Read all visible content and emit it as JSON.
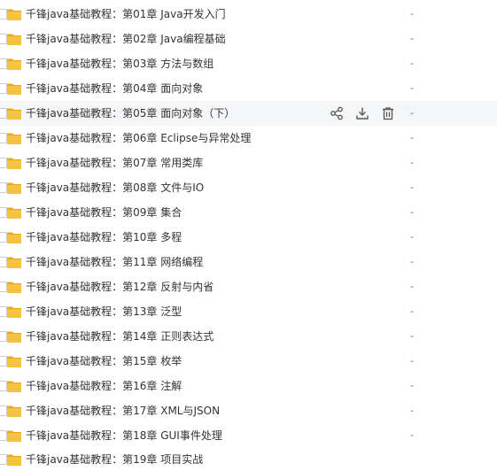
{
  "files": [
    {
      "name": "千锋java基础教程：第01章 Java开发入门",
      "size": "-"
    },
    {
      "name": "千锋java基础教程：第02章 Java编程基础",
      "size": "-"
    },
    {
      "name": "千锋java基础教程：第03章 方法与数组",
      "size": "-"
    },
    {
      "name": "千锋java基础教程：第04章 面向对象",
      "size": "-"
    },
    {
      "name": "千锋java基础教程：第05章 面向对象（下）",
      "size": "-"
    },
    {
      "name": "千锋java基础教程：第06章 Eclipse与异常处理",
      "size": "-"
    },
    {
      "name": "千锋java基础教程：第07章 常用类库",
      "size": "-"
    },
    {
      "name": "千锋java基础教程：第08章 文件与IO",
      "size": "-"
    },
    {
      "name": "千锋java基础教程：第09章 集合",
      "size": "-"
    },
    {
      "name": "千锋java基础教程：第10章 多程",
      "size": "-"
    },
    {
      "name": "千锋java基础教程：第11章 网络编程",
      "size": "-"
    },
    {
      "name": "千锋java基础教程：第12章 反射与内省",
      "size": "-"
    },
    {
      "name": "千锋java基础教程：第13章 泛型",
      "size": "-"
    },
    {
      "name": "千锋java基础教程：第14章 正则表达式",
      "size": "-"
    },
    {
      "name": "千锋java基础教程：第15章 枚举",
      "size": "-"
    },
    {
      "name": "千锋java基础教程：第16章 注解",
      "size": "-"
    },
    {
      "name": "千锋java基础教程：第17章 XML与JSON",
      "size": "-"
    },
    {
      "name": "千锋java基础教程：第18章 GUI事件处理",
      "size": "-"
    },
    {
      "name": "千锋java基础教程：第19章 项目实战",
      "size": "-"
    }
  ],
  "hovered_row": 4,
  "row_actions": [
    "share-icon",
    "download-icon",
    "delete-icon"
  ],
  "colors": {
    "folder": "#f5c342",
    "folder_tab": "#e8aa1c",
    "hover": "#f5f6f8",
    "icon": "#555555"
  }
}
